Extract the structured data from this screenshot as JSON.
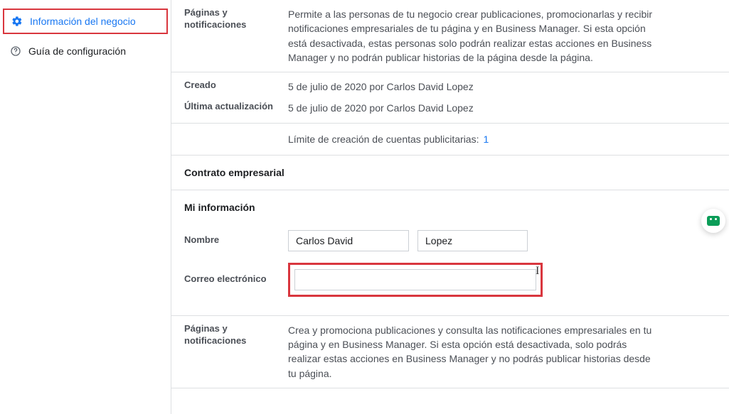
{
  "sidebar": {
    "items": [
      {
        "label": "Información del negocio",
        "icon": "gear-icon",
        "active": true
      },
      {
        "label": "Guía de configuración",
        "icon": "help-icon",
        "active": false
      }
    ]
  },
  "main": {
    "paginas_notificaciones": {
      "label": "Páginas y notificaciones",
      "text": "Permite a las personas de tu negocio crear publicaciones, promocionarlas y recibir notificaciones empresariales de tu página y en Business Manager. Si esta opción está desactivada, estas personas solo podrán realizar estas acciones en Business Manager y no podrán publicar historias de la página desde la página."
    },
    "creado": {
      "label": "Creado",
      "value": "5 de julio de 2020 por Carlos David Lopez"
    },
    "ultima_actualizacion": {
      "label": "Última actualización",
      "value": "5 de julio de 2020 por Carlos David Lopez"
    },
    "limite": {
      "label": "Límite de creación de cuentas publicitarias:",
      "count": "1"
    },
    "contrato_heading": "Contrato empresarial",
    "mi_info_heading": "Mi información",
    "nombre": {
      "label": "Nombre",
      "first": "Carlos David",
      "last": "Lopez"
    },
    "correo": {
      "label": "Correo electrónico",
      "value": ""
    },
    "paginas_notificaciones_2": {
      "label": "Páginas y notificaciones",
      "text": "Crea y promociona publicaciones y consulta las notificaciones empresariales en tu página y en Business Manager. Si esta opción está desactivada, solo podrás realizar estas acciones en Business Manager y no podrás publicar historias desde tu página."
    }
  }
}
